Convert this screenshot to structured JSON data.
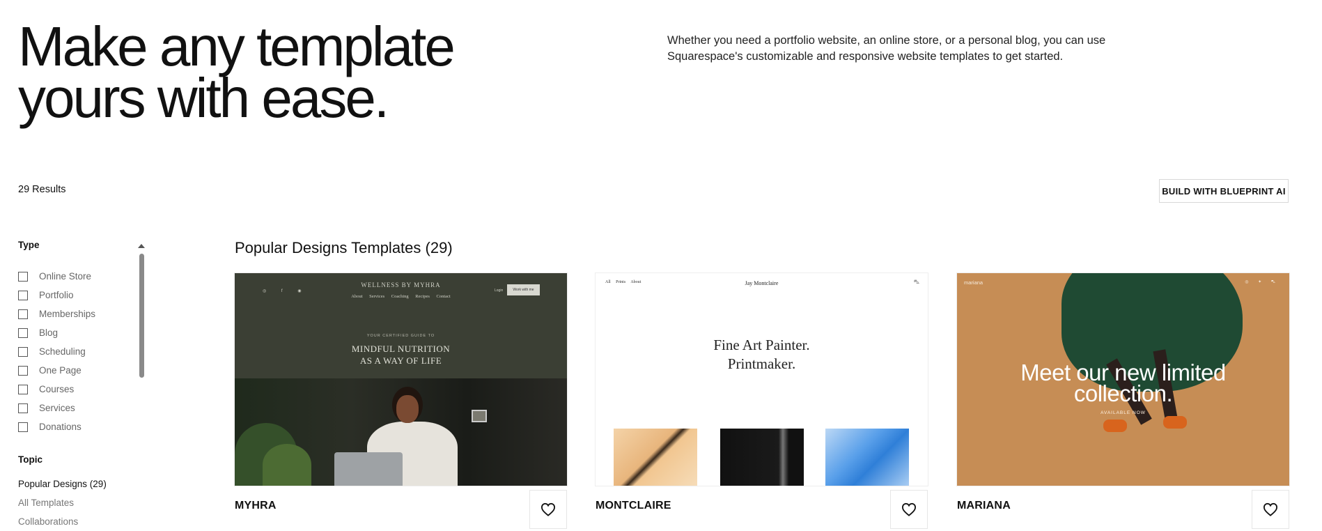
{
  "hero": {
    "title_line1": "Make any template",
    "title_line2": "yours with ease.",
    "description": "Whether you need a portfolio website, an online store, or a personal blog, you can use Squarespace's customizable and responsive website templates to get started."
  },
  "results": {
    "count_label": "29 Results"
  },
  "blueprint_button": {
    "label": "BUILD WITH BLUEPRINT AI"
  },
  "sidebar": {
    "type_heading": "Type",
    "type_filters": [
      {
        "label": "Online Store"
      },
      {
        "label": "Portfolio"
      },
      {
        "label": "Memberships"
      },
      {
        "label": "Blog"
      },
      {
        "label": "Scheduling"
      },
      {
        "label": "One Page"
      },
      {
        "label": "Courses"
      },
      {
        "label": "Services"
      },
      {
        "label": "Donations"
      }
    ],
    "topic_heading": "Topic",
    "topics": [
      {
        "label": "Popular Designs (29)"
      },
      {
        "label": "All Templates"
      },
      {
        "label": "Collaborations"
      }
    ]
  },
  "section": {
    "title": "Popular Designs Templates (29)"
  },
  "cards": [
    {
      "name": "MYHRA",
      "preview": {
        "brand": "WELLNESS BY MYHRA",
        "nav": "About Services Coaching Recipes Contact",
        "login": "Login",
        "cta": "Work with me",
        "kicker": "YOUR CERTIFIED GUIDE TO",
        "headline_line1": "MINDFUL NUTRITION",
        "headline_line2": "AS A WAY OF LIFE"
      }
    },
    {
      "name": "MONTCLAIRE",
      "preview": {
        "nav": "All Prints About",
        "brand": "Jay Montclaire",
        "headline_line1": "Fine Art Painter.",
        "headline_line2": "Printmaker."
      }
    },
    {
      "name": "MARIANA",
      "preview": {
        "brand": "mariana",
        "headline_line1": "Meet our new limited",
        "headline_line2": "collection.",
        "sub": "AVAILABLE NOW"
      }
    }
  ],
  "icons": {
    "favorite": "heart-icon",
    "checkbox": "checkbox-icon",
    "scroll": "caret-up-icon",
    "cart": "cart-icon"
  },
  "colors": {
    "myhra_green": "#3b3f34",
    "mariana_tan": "#c68d55",
    "text": "#111111"
  }
}
